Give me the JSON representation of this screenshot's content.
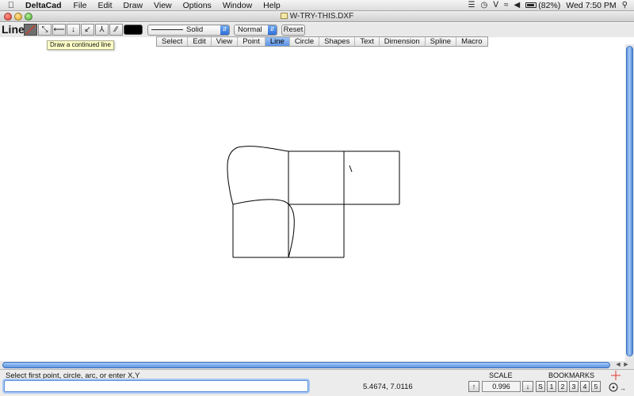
{
  "menubar": {
    "app_name": "DeltaCad",
    "items": [
      "File",
      "Edit",
      "Draw",
      "View",
      "Options",
      "Window",
      "Help"
    ],
    "battery": "(82%)",
    "clock": "Wed 7:50 PM"
  },
  "window": {
    "title": "W-TRY-THIS.DXF"
  },
  "toolbar": {
    "tool_name": "Line",
    "tool_buttons": [
      {
        "icon": "continued-line-icon",
        "glyph": "╱",
        "active": true
      },
      {
        "icon": "line-chain-icon",
        "glyph": "⤡"
      },
      {
        "icon": "horizontal-line-icon",
        "glyph": "⟵"
      },
      {
        "icon": "vertical-line-icon",
        "glyph": "↓"
      },
      {
        "icon": "angled-line-icon",
        "glyph": "↙"
      },
      {
        "icon": "bisector-line-icon",
        "glyph": "⅄"
      },
      {
        "icon": "parallel-line-icon",
        "glyph": "∕∕"
      }
    ],
    "line_color": "#000000",
    "linetype_value": "Solid",
    "weight_value": "Normal",
    "reset_label": "Reset"
  },
  "tooltip": {
    "text": "Draw a continued line"
  },
  "mode_tabs": [
    {
      "label": "Select"
    },
    {
      "label": "Edit"
    },
    {
      "label": "View"
    },
    {
      "label": "Point"
    },
    {
      "label": "Line",
      "active": true
    },
    {
      "label": "Circle"
    },
    {
      "label": "Shapes"
    },
    {
      "label": "Text"
    },
    {
      "label": "Dimension"
    },
    {
      "label": "Spline"
    },
    {
      "label": "Macro"
    }
  ],
  "status": {
    "prompt": "Select first point, circle, arc, or enter X,Y",
    "command_value": "",
    "coordinates": "5.4674, 7.0116",
    "scale_label": "SCALE",
    "scale_value": "0.996",
    "bookmarks_label": "BOOKMARKS",
    "bookmarks": [
      "S",
      "1",
      "2",
      "3",
      "4",
      "5"
    ]
  },
  "colors": {
    "accent": "#5c94e6",
    "drawing_stroke": "#000000"
  }
}
